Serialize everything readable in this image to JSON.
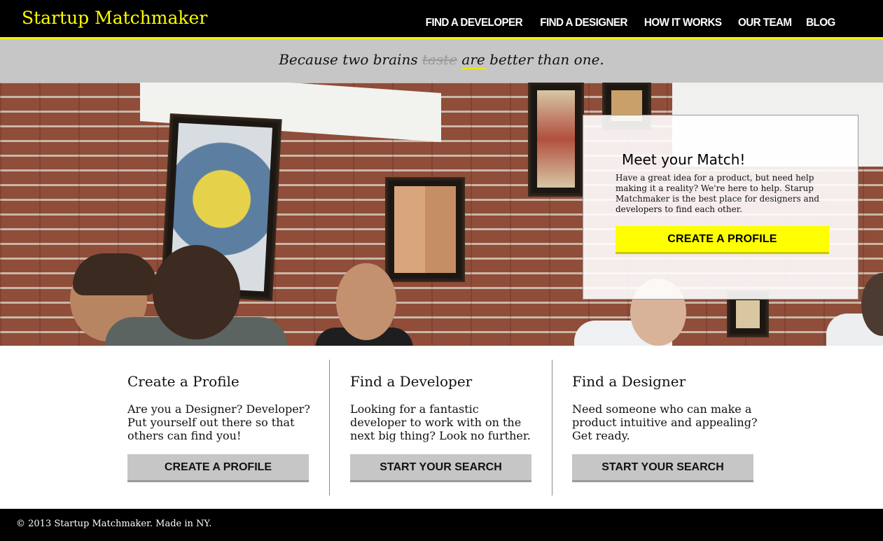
{
  "header": {
    "logo": "Startup Matchmaker",
    "nav": [
      "FIND A DEVELOPER",
      "FIND A DESIGNER",
      "HOW IT WORKS",
      "OUR TEAM",
      "BLOG"
    ]
  },
  "tagline": {
    "before": "Because two brains ",
    "struck": "taste",
    "are": "are",
    "after": " better than one."
  },
  "hero": {
    "card_title": "Meet your Match!",
    "card_text": "Have a great idea for a product, but need help making it a reality? We're here to help. Starup Matchmaker is the best place for designers and developers to find each other.",
    "card_button": "CREATE A PROFILE"
  },
  "features": [
    {
      "title": "Create a Profile",
      "text": "Are you a Designer? Developer? Put yourself out there so that others can find you!",
      "button": "CREATE A PROFILE"
    },
    {
      "title": "Find a Developer",
      "text": "Looking for a fantastic developer to work with on the next big thing? Look no further.",
      "button": "START YOUR SEARCH"
    },
    {
      "title": "Find a Designer",
      "text": "Need someone who can make a product intuitive and appealing? Get ready.",
      "button": "START YOUR SEARCH"
    }
  ],
  "footer": {
    "text": "© 2013 Startup Matchmaker. Made in NY."
  },
  "colors": {
    "accent": "#ffff00",
    "header_bg": "#000000",
    "tagline_bg": "#c6c6c6",
    "button_gray": "#c6c6c6"
  }
}
